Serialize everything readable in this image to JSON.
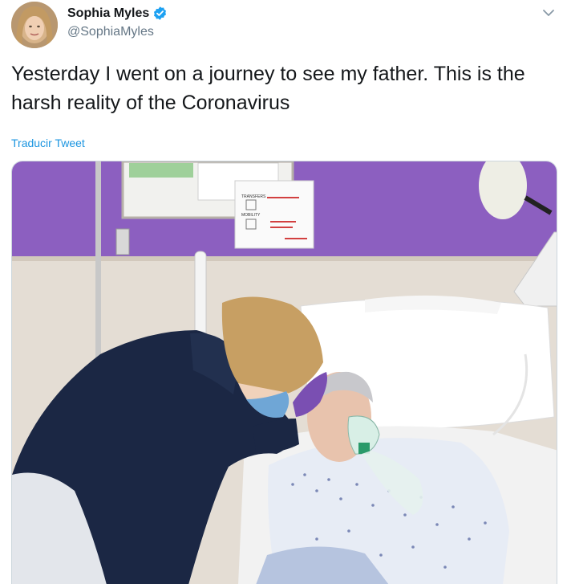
{
  "author": {
    "display_name": "Sophia Myles",
    "handle": "@SophiaMyles",
    "verified": true,
    "avatar_icon": "avatar-photo"
  },
  "tweet": {
    "text": "Yesterday I went on a journey to see my father. This is the harsh reality of the Coronavirus",
    "translate_label": "Traducir Tweet"
  },
  "media": {
    "icon": "photo-hospital-bedside",
    "sign_lines": [
      "TRANSFERS",
      "MOBILITY"
    ]
  },
  "colors": {
    "text_primary": "#14171a",
    "text_secondary": "#657786",
    "link": "#1b95e0",
    "verified": "#1da1f2",
    "wall_purple": "#8c5fc0"
  }
}
